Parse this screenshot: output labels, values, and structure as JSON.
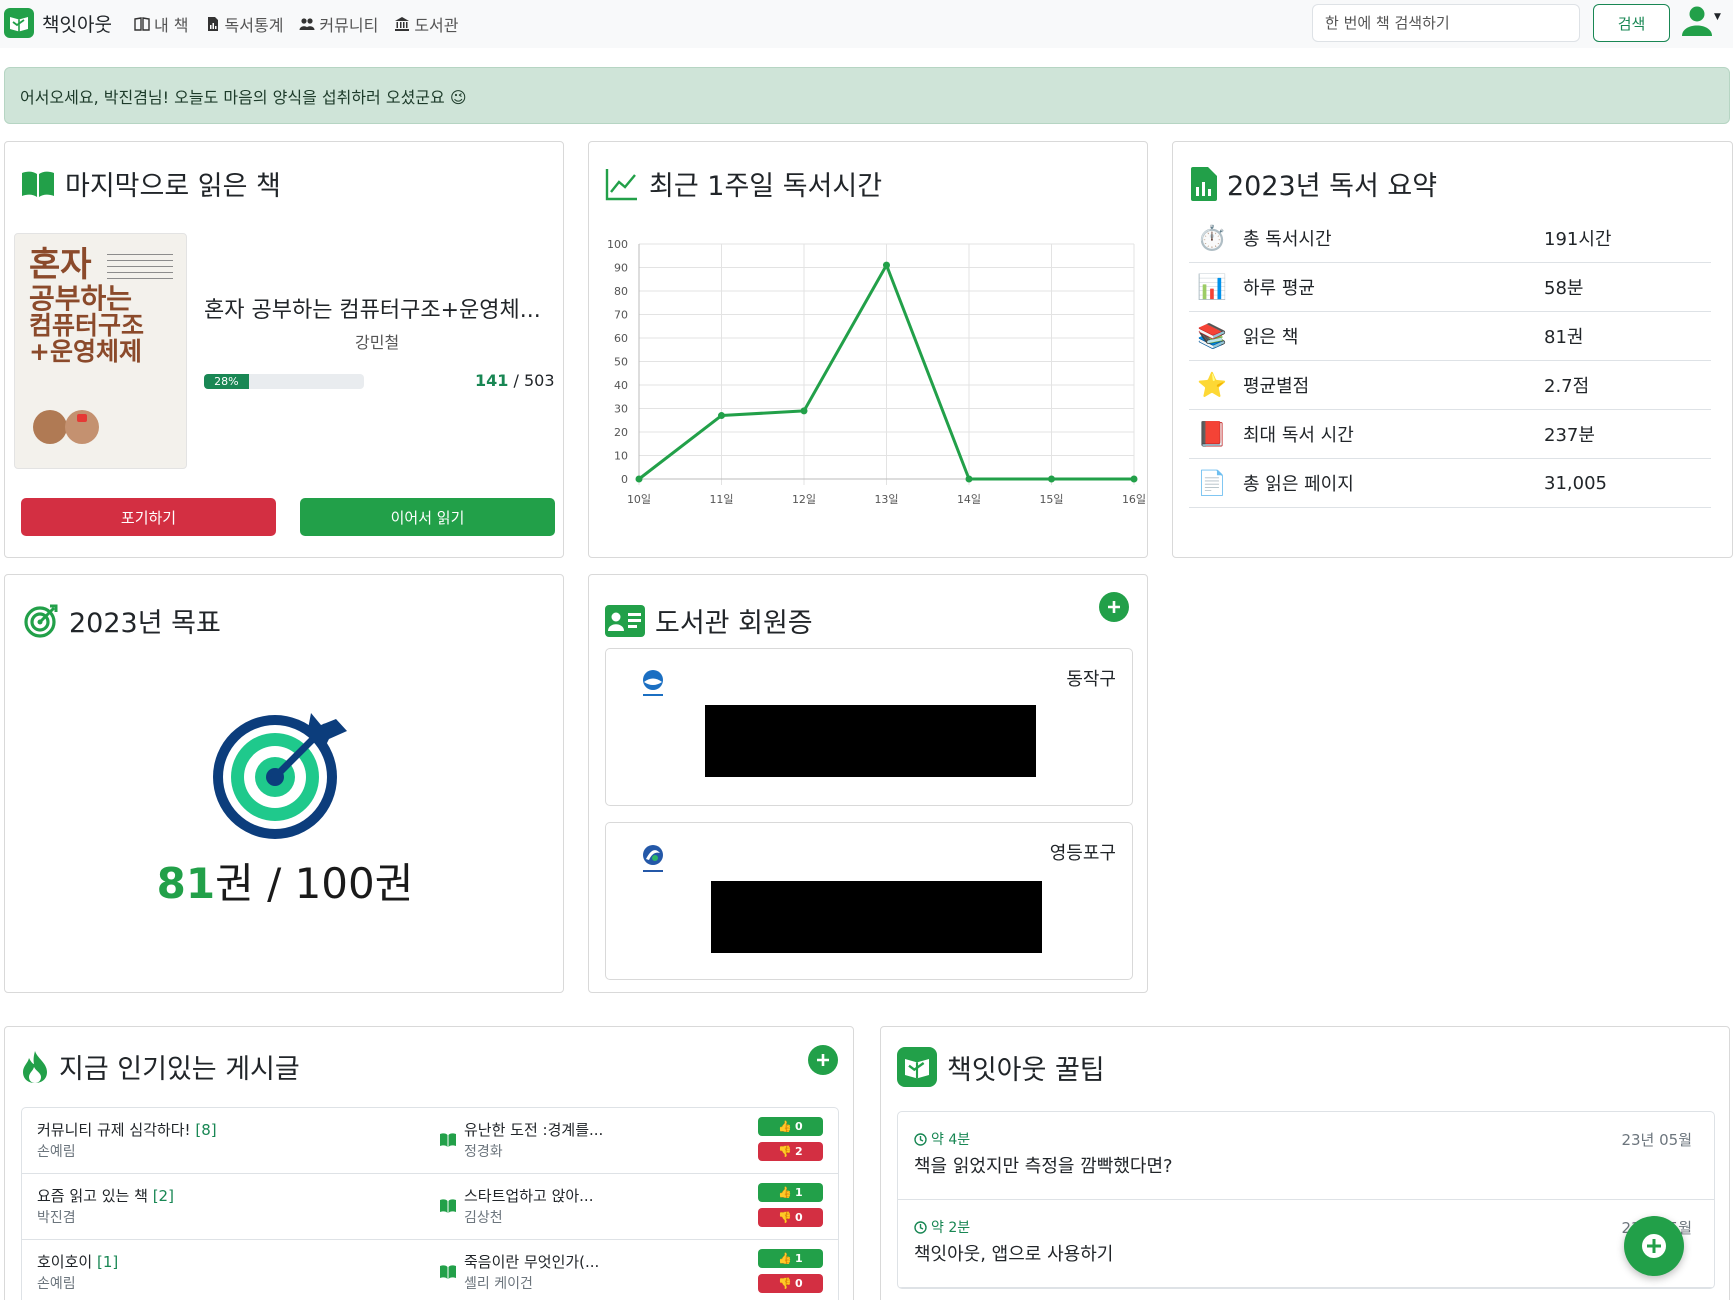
{
  "nav": {
    "brand": "책잇아웃",
    "links": [
      "내 책",
      "독서통계",
      "커뮤니티",
      "도서관"
    ],
    "search_placeholder": "한 번에 책 검색하기",
    "search_button": "검색"
  },
  "welcome": "어서오세요, 박진겸님! 오늘도 마음의 양식을 섭취하러 오셨군요 😉",
  "last_read": {
    "heading": "마지막으로 읽은 책",
    "title": "혼자 공부하는 컴퓨터구조+운영체...",
    "author": "강민철",
    "progress_label": "28%",
    "progress": 0.28,
    "current_page": "141",
    "total_pages": "/ 503",
    "give_up": "포기하기",
    "continue": "이어서 읽기",
    "cover_text": [
      "혼자",
      "공부하는",
      "컴퓨터구조",
      "+운영체제"
    ]
  },
  "weekly": {
    "heading": "최근 1주일 독서시간"
  },
  "chart_data": {
    "type": "line",
    "categories": [
      "10일",
      "11일",
      "12일",
      "13일",
      "14일",
      "15일",
      "16일"
    ],
    "values": [
      0,
      27,
      29,
      91,
      0,
      0,
      0
    ],
    "ylim": [
      0,
      100
    ],
    "yticks": [
      "0",
      "10",
      "20",
      "30",
      "40",
      "50",
      "60",
      "70",
      "80",
      "90",
      "100"
    ],
    "color": "#22a049",
    "grid": true
  },
  "summary": {
    "heading": "2023년 독서 요약",
    "rows": [
      {
        "icon": "stopwatch-icon",
        "label": "총 독서시간",
        "value": "191시간"
      },
      {
        "icon": "bar-chart-icon",
        "label": "하루 평균",
        "value": "58분"
      },
      {
        "icon": "books-icon",
        "label": "읽은 책",
        "value": "81권"
      },
      {
        "icon": "star-icon",
        "label": "평균별점",
        "value": "2.7점"
      },
      {
        "icon": "book-magnet-icon",
        "label": "최대 독서 시간",
        "value": "237분"
      },
      {
        "icon": "document-icon",
        "label": "총 읽은 페이지",
        "value": "31,005"
      }
    ]
  },
  "goal": {
    "heading": "2023년 목표",
    "current": "81",
    "rest": "권 / 100권",
    "progress": 0.81
  },
  "library": {
    "heading": "도서관 회원증",
    "cards": [
      {
        "name": "동작구",
        "logo_label": "동작구"
      },
      {
        "name": "영등포구",
        "logo_label": "영등포구"
      }
    ]
  },
  "posts": {
    "heading": "지금 인기있는 게시글",
    "rows": [
      {
        "title": "커뮤니티 규제 심각하다!",
        "count": "[8]",
        "author": "손예림",
        "book": "유난한 도전 :경계를...",
        "book_author": "정경화",
        "likes": "0",
        "dislikes": "2"
      },
      {
        "title": "요즘 읽고 있는 책",
        "count": "[2]",
        "author": "박진겸",
        "book": "스타트업하고 앉아...",
        "book_author": "김상천",
        "likes": "1",
        "dislikes": "0"
      },
      {
        "title": "호이호이",
        "count": "[1]",
        "author": "손예림",
        "book": "죽음이란 무엇인가(...",
        "book_author": "셸리 케이건",
        "likes": "1",
        "dislikes": "0"
      }
    ]
  },
  "tips": {
    "heading": "책잇아웃 꿀팁",
    "rows": [
      {
        "time": "약 4분",
        "title": "책을 읽었지만 측정을 깜빡했다면?",
        "date": "23년 05월"
      },
      {
        "time": "약 2분",
        "title": "책잇아웃, 앱으로 사용하기",
        "date": "23년 05월"
      }
    ]
  },
  "colors": {
    "brand_green": "#22a049",
    "danger_red": "#d32f42",
    "alert_bg": "#cfe4d8"
  }
}
